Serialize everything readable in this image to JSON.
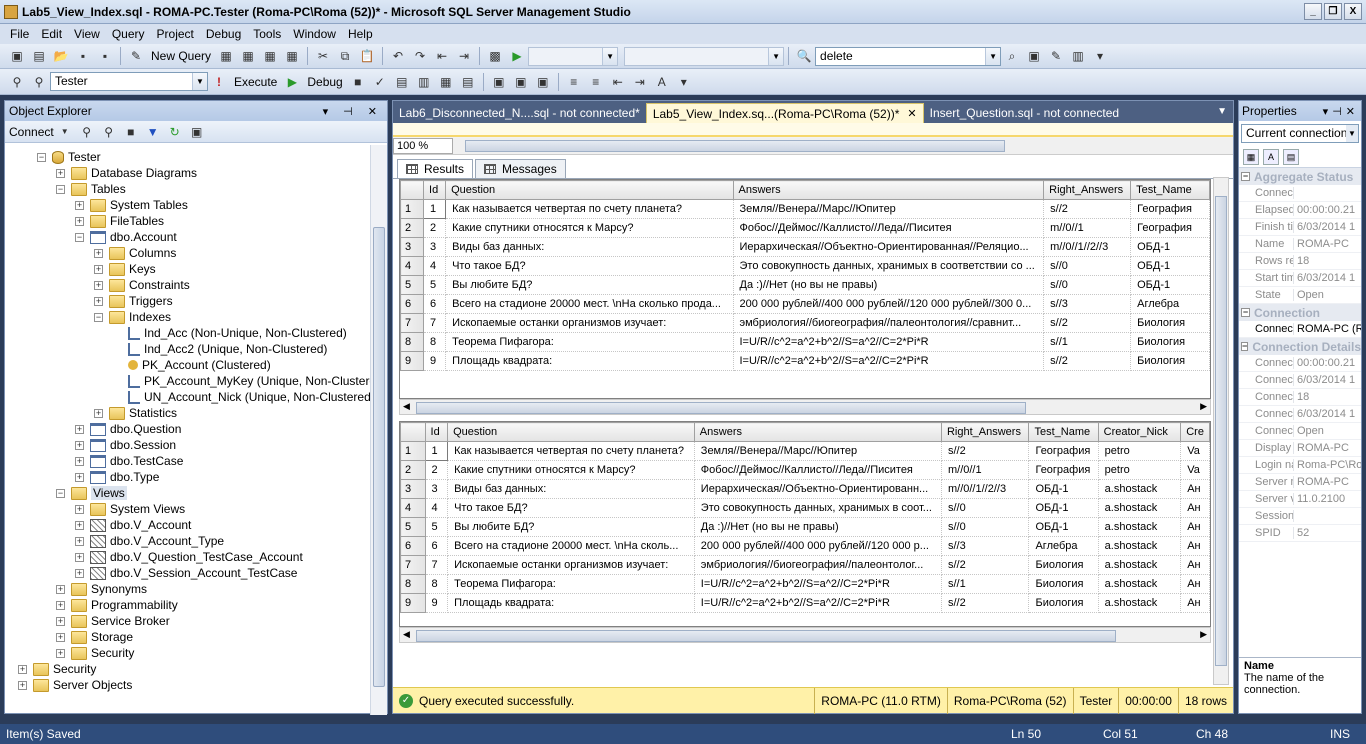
{
  "window": {
    "title": "Lab5_View_Index.sql - ROMA-PC.Tester (Roma-PC\\Roma (52))* - Microsoft SQL Server Management Studio",
    "controls": [
      "_",
      "❒",
      "X"
    ]
  },
  "menu": [
    "File",
    "Edit",
    "View",
    "Query",
    "Project",
    "Debug",
    "Tools",
    "Window",
    "Help"
  ],
  "toolbar1": {
    "new_query_label": "New Query",
    "search_combo_value": "delete"
  },
  "toolbar2": {
    "database_value": "Tester",
    "execute_label": "Execute",
    "debug_label": "Debug"
  },
  "object_explorer": {
    "title": "Object Explorer",
    "connect_label": "Connect",
    "tree": [
      {
        "label": "Tester",
        "indent": 0,
        "icon": "db",
        "exp": "-"
      },
      {
        "label": "Database Diagrams",
        "indent": 1,
        "icon": "folder",
        "exp": "+"
      },
      {
        "label": "Tables",
        "indent": 1,
        "icon": "folder",
        "exp": "-"
      },
      {
        "label": "System Tables",
        "indent": 2,
        "icon": "folder",
        "exp": "+"
      },
      {
        "label": "FileTables",
        "indent": 2,
        "icon": "folder",
        "exp": "+"
      },
      {
        "label": "dbo.Account",
        "indent": 2,
        "icon": "table",
        "exp": "-"
      },
      {
        "label": "Columns",
        "indent": 3,
        "icon": "folder",
        "exp": "+"
      },
      {
        "label": "Keys",
        "indent": 3,
        "icon": "folder",
        "exp": "+"
      },
      {
        "label": "Constraints",
        "indent": 3,
        "icon": "folder",
        "exp": "+"
      },
      {
        "label": "Triggers",
        "indent": 3,
        "icon": "folder",
        "exp": "+"
      },
      {
        "label": "Indexes",
        "indent": 3,
        "icon": "folder",
        "exp": "-"
      },
      {
        "label": "Ind_Acc (Non-Unique, Non-Clustered)",
        "indent": 4,
        "icon": "index",
        "exp": ""
      },
      {
        "label": "Ind_Acc2 (Unique, Non-Clustered)",
        "indent": 4,
        "icon": "index",
        "exp": ""
      },
      {
        "label": "PK_Account (Clustered)",
        "indent": 4,
        "icon": "key",
        "exp": ""
      },
      {
        "label": "PK_Account_MyKey (Unique, Non-Clustere",
        "indent": 4,
        "icon": "index",
        "exp": ""
      },
      {
        "label": "UN_Account_Nick (Unique, Non-Clustered)",
        "indent": 4,
        "icon": "index",
        "exp": ""
      },
      {
        "label": "Statistics",
        "indent": 3,
        "icon": "folder",
        "exp": "+"
      },
      {
        "label": "dbo.Question",
        "indent": 2,
        "icon": "table",
        "exp": "+"
      },
      {
        "label": "dbo.Session",
        "indent": 2,
        "icon": "table",
        "exp": "+"
      },
      {
        "label": "dbo.TestCase",
        "indent": 2,
        "icon": "table",
        "exp": "+"
      },
      {
        "label": "dbo.Type",
        "indent": 2,
        "icon": "table",
        "exp": "+"
      },
      {
        "label": "Views",
        "indent": 1,
        "icon": "folder",
        "exp": "-"
      },
      {
        "label": "System Views",
        "indent": 2,
        "icon": "folder",
        "exp": "+"
      },
      {
        "label": "dbo.V_Account",
        "indent": 2,
        "icon": "view",
        "exp": "+"
      },
      {
        "label": "dbo.V_Account_Type",
        "indent": 2,
        "icon": "view",
        "exp": "+"
      },
      {
        "label": "dbo.V_Question_TestCase_Account",
        "indent": 2,
        "icon": "view",
        "exp": "+"
      },
      {
        "label": "dbo.V_Session_Account_TestCase",
        "indent": 2,
        "icon": "view",
        "exp": "+"
      },
      {
        "label": "Synonyms",
        "indent": 1,
        "icon": "folder",
        "exp": "+"
      },
      {
        "label": "Programmability",
        "indent": 1,
        "icon": "folder",
        "exp": "+"
      },
      {
        "label": "Service Broker",
        "indent": 1,
        "icon": "folder",
        "exp": "+"
      },
      {
        "label": "Storage",
        "indent": 1,
        "icon": "folder",
        "exp": "+"
      },
      {
        "label": "Security",
        "indent": 1,
        "icon": "folder",
        "exp": "+"
      },
      {
        "label": "Security",
        "indent": -1,
        "icon": "folder",
        "exp": "+"
      },
      {
        "label": "Server Objects",
        "indent": -1,
        "icon": "folder",
        "exp": "+"
      }
    ]
  },
  "document": {
    "tabs": [
      {
        "label": "Lab6_Disconnected_N....sql - not connected*",
        "active": false
      },
      {
        "label": "Lab5_View_Index.sq...(Roma-PC\\Roma (52))*",
        "active": true
      },
      {
        "label": "Insert_Question.sql - not connected",
        "active": false
      }
    ],
    "zoom": "100 %",
    "result_tabs": [
      "Results",
      "Messages"
    ]
  },
  "grid1": {
    "columns": [
      "Id",
      "Question",
      "Answers",
      "Right_Answers",
      "Test_Name"
    ],
    "rows": [
      [
        "1",
        "1",
        "Как называется четвертая по счету планета?",
        "Земля//Венера//Марс//Юпитер",
        "s//2",
        "География"
      ],
      [
        "2",
        "2",
        "Какие спутники относятся к Марсу?",
        "Фобос//Деймос//Каллисто//Леда//Писитея",
        "m//0//1",
        "География"
      ],
      [
        "3",
        "3",
        "Виды баз данных:",
        "Иерархическая//Объектно-Ориентированная//Реляцио...",
        "m//0//1//2//3",
        "ОБД-1"
      ],
      [
        "4",
        "4",
        "Что такое БД?",
        "Это совокупность данных, хранимых в соответствии со ...",
        "s//0",
        "ОБД-1"
      ],
      [
        "5",
        "5",
        "Вы любите БД?",
        "Да :)//Нет (но вы не правы)",
        "s//0",
        "ОБД-1"
      ],
      [
        "6",
        "6",
        "Всего на стадионе 20000 мест. \\nНа сколько прода...",
        "200 000 рублей//400 000 рублей//120 000 рублей//300 0...",
        "s//3",
        "Аглебра"
      ],
      [
        "7",
        "7",
        "Ископаемые останки организмов изучает:",
        "эмбриология//биогеография//палеонтология//сравнит...",
        "s//2",
        "Биология"
      ],
      [
        "8",
        "8",
        "Теорема Пифагора:",
        "I=U/R//c^2=a^2+b^2//S=a^2//C=2*Pi*R",
        "s//1",
        "Биология"
      ],
      [
        "9",
        "9",
        "Площадь квадрата:",
        "I=U/R//c^2=a^2+b^2//S=a^2//C=2*Pi*R",
        "s//2",
        "Биология"
      ]
    ]
  },
  "grid2": {
    "columns": [
      "Id",
      "Question",
      "Answers",
      "Right_Answers",
      "Test_Name",
      "Creator_Nick",
      "Cre"
    ],
    "rows": [
      [
        "1",
        "1",
        "Как называется четвертая по счету планета?",
        "Земля//Венера//Марс//Юпитер",
        "s//2",
        "География",
        "petro",
        "Va"
      ],
      [
        "2",
        "2",
        "Какие спутники относятся к Марсу?",
        "Фобос//Деймос//Каллисто//Леда//Писитея",
        "m//0//1",
        "География",
        "petro",
        "Va"
      ],
      [
        "3",
        "3",
        "Виды баз данных:",
        "Иерархическая//Объектно-Ориентированн...",
        "m//0//1//2//3",
        "ОБД-1",
        "a.shostack",
        "Ан"
      ],
      [
        "4",
        "4",
        "Что такое БД?",
        "Это совокупность данных, хранимых в соот...",
        "s//0",
        "ОБД-1",
        "a.shostack",
        "Ан"
      ],
      [
        "5",
        "5",
        "Вы любите БД?",
        "Да :)//Нет (но вы не правы)",
        "s//0",
        "ОБД-1",
        "a.shostack",
        "Ан"
      ],
      [
        "6",
        "6",
        "Всего на стадионе 20000 мест. \\nНа сколь...",
        "200 000 рублей//400 000 рублей//120 000 р...",
        "s//3",
        "Аглебра",
        "a.shostack",
        "Ан"
      ],
      [
        "7",
        "7",
        "Ископаемые останки организмов изучает:",
        "эмбриология//биогеография//палеонтолог...",
        "s//2",
        "Биология",
        "a.shostack",
        "Ан"
      ],
      [
        "8",
        "8",
        "Теорема Пифагора:",
        "I=U/R//c^2=a^2+b^2//S=a^2//C=2*Pi*R",
        "s//1",
        "Биология",
        "a.shostack",
        "Ан"
      ],
      [
        "9",
        "9",
        "Площадь квадрата:",
        "I=U/R//c^2=a^2+b^2//S=a^2//C=2*Pi*R",
        "s//2",
        "Биология",
        "a.shostack",
        "Ан"
      ]
    ]
  },
  "query_status": {
    "message": "Query executed successfully.",
    "server": "ROMA-PC (11.0 RTM)",
    "login": "Roma-PC\\Roma (52)",
    "database": "Tester",
    "elapsed": "00:00:00",
    "rows": "18 rows"
  },
  "properties": {
    "title": "Properties",
    "selected_object": "Current connection",
    "categories": [
      {
        "name": "Aggregate Status",
        "rows": [
          [
            "Connect",
            ""
          ],
          [
            "Elapsed",
            "00:00:00.21"
          ],
          [
            "Finish tir",
            "6/03/2014 1"
          ],
          [
            "Name",
            "ROMA-PC"
          ],
          [
            "Rows re",
            "18"
          ],
          [
            "Start tim",
            "6/03/2014 1"
          ],
          [
            "State",
            "Open"
          ]
        ]
      },
      {
        "name": "Connection",
        "rows": [
          [
            "Connect",
            "ROMA-PC (R"
          ]
        ]
      },
      {
        "name": "Connection Details",
        "rows": [
          [
            "Connect",
            "00:00:00.21"
          ],
          [
            "Connect",
            "6/03/2014 1"
          ],
          [
            "Connect",
            "18"
          ],
          [
            "Connect",
            "6/03/2014 1"
          ],
          [
            "Connect",
            "Open"
          ],
          [
            "Display n",
            "ROMA-PC"
          ],
          [
            "Login na",
            "Roma-PC\\Ro"
          ],
          [
            "Server n",
            "ROMA-PC"
          ],
          [
            "Server v",
            "11.0.2100"
          ],
          [
            "Session",
            ""
          ],
          [
            "SPID",
            "52"
          ]
        ]
      }
    ],
    "description_title": "Name",
    "description_text": "The name of the connection."
  },
  "statusbar": {
    "left": "Item(s) Saved",
    "ln": "Ln 50",
    "col": "Col 51",
    "ch": "Ch 48",
    "mode": "INS"
  }
}
